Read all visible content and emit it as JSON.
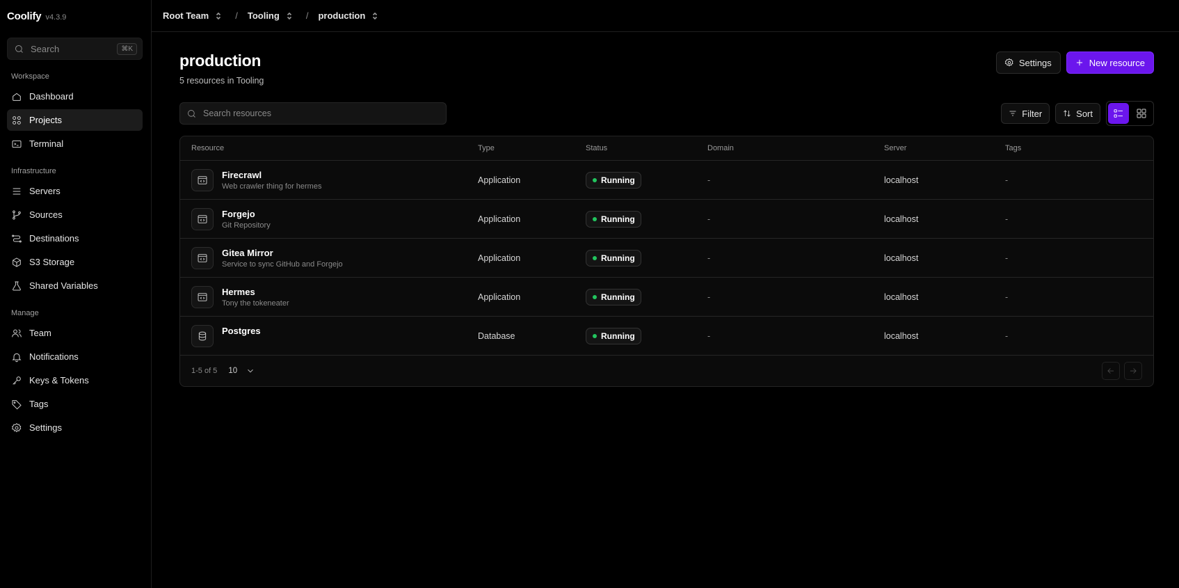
{
  "app": {
    "name": "Coolify",
    "version": "v4.3.9"
  },
  "sidebar": {
    "search_label": "Search",
    "search_shortcut": "⌘K",
    "sections": {
      "workspace": "Workspace",
      "infrastructure": "Infrastructure",
      "manage": "Manage"
    },
    "items": {
      "dashboard": "Dashboard",
      "projects": "Projects",
      "terminal": "Terminal",
      "servers": "Servers",
      "sources": "Sources",
      "destinations": "Destinations",
      "s3_storage": "S3 Storage",
      "shared_variables": "Shared Variables",
      "team": "Team",
      "notifications": "Notifications",
      "keys_tokens": "Keys & Tokens",
      "tags": "Tags",
      "settings": "Settings"
    },
    "active_item": "projects"
  },
  "breadcrumb": {
    "team": "Root Team",
    "project": "Tooling",
    "environment": "production",
    "separator": "/"
  },
  "header": {
    "title": "production",
    "subtitle": "5 resources in Tooling",
    "settings_label": "Settings",
    "new_resource_label": "New resource"
  },
  "toolbar": {
    "search_placeholder": "Search resources",
    "filter_label": "Filter",
    "sort_label": "Sort",
    "active_view": "list"
  },
  "table": {
    "columns": {
      "resource": "Resource",
      "type": "Type",
      "status": "Status",
      "domain": "Domain",
      "server": "Server",
      "tags": "Tags"
    },
    "rows": [
      {
        "name": "Firecrawl",
        "description": "Web crawler thing for hermes",
        "icon": "application-icon",
        "type": "Application",
        "status": "Running",
        "domain": "-",
        "server": "localhost",
        "tags": "-"
      },
      {
        "name": "Forgejo",
        "description": "Git Repository",
        "icon": "application-icon",
        "type": "Application",
        "status": "Running",
        "domain": "-",
        "server": "localhost",
        "tags": "-"
      },
      {
        "name": "Gitea Mirror",
        "description": "Service to sync GitHub and Forgejo",
        "icon": "application-icon",
        "type": "Application",
        "status": "Running",
        "domain": "-",
        "server": "localhost",
        "tags": "-"
      },
      {
        "name": "Hermes",
        "description": "Tony the tokeneater",
        "icon": "application-icon",
        "type": "Application",
        "status": "Running",
        "domain": "-",
        "server": "localhost",
        "tags": "-"
      },
      {
        "name": "Postgres",
        "description": "",
        "icon": "database-icon",
        "type": "Database",
        "status": "Running",
        "domain": "-",
        "server": "localhost",
        "tags": "-"
      }
    ],
    "status_color": "#22c55e"
  },
  "pagination": {
    "range": "1-5 of 5",
    "page_size": "10"
  },
  "colors": {
    "accent": "#6b16ed",
    "background": "#000000"
  }
}
